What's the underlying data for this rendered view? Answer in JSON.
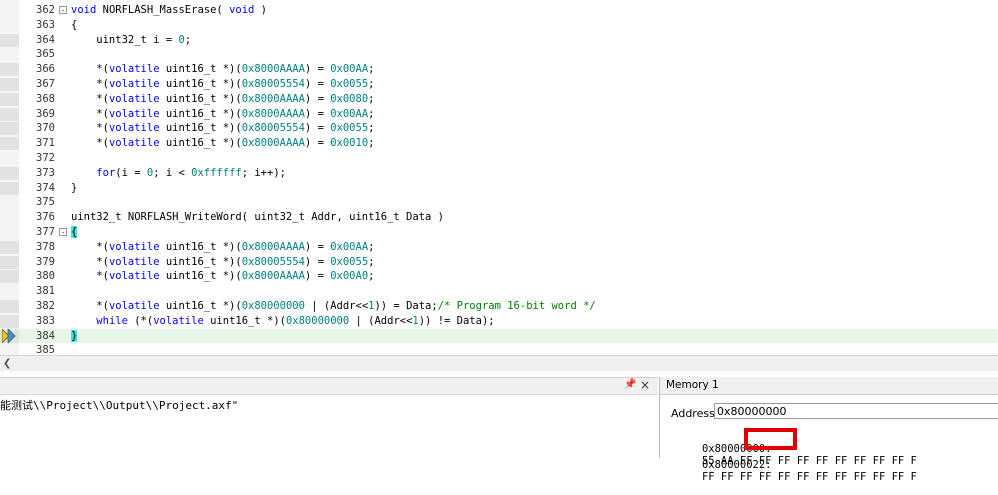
{
  "editor": {
    "current_line": "384",
    "lines": [
      {
        "num": "362",
        "text": "void NORFLASH_MassErase( void )",
        "fold": "-"
      },
      {
        "num": "363",
        "text": "{"
      },
      {
        "num": "364",
        "text": "    uint32_t i = 0;",
        "bp": true
      },
      {
        "num": "365",
        "text": ""
      },
      {
        "num": "366",
        "text": "    *(volatile uint16_t *)(0x8000AAAA) = 0x00AA;",
        "bp": true
      },
      {
        "num": "367",
        "text": "    *(volatile uint16_t *)(0x80005554) = 0x0055;",
        "bp": true
      },
      {
        "num": "368",
        "text": "    *(volatile uint16_t *)(0x8000AAAA) = 0x0080;",
        "bp": true
      },
      {
        "num": "369",
        "text": "    *(volatile uint16_t *)(0x8000AAAA) = 0x00AA;",
        "bp": true
      },
      {
        "num": "370",
        "text": "    *(volatile uint16_t *)(0x80005554) = 0x0055;",
        "bp": true
      },
      {
        "num": "371",
        "text": "    *(volatile uint16_t *)(0x8000AAAA) = 0x0010;",
        "bp": true
      },
      {
        "num": "372",
        "text": ""
      },
      {
        "num": "373",
        "text": "    for(i = 0; i < 0xffffff; i++);",
        "bp": true
      },
      {
        "num": "374",
        "text": "}",
        "bp": true
      },
      {
        "num": "375",
        "text": ""
      },
      {
        "num": "376",
        "text": "uint32_t NORFLASH_WriteWord( uint32_t Addr, uint16_t Data )"
      },
      {
        "num": "377",
        "text": "{",
        "fold": "-"
      },
      {
        "num": "378",
        "text": "    *(volatile uint16_t *)(0x8000AAAA) = 0x00AA;",
        "bp": true
      },
      {
        "num": "379",
        "text": "    *(volatile uint16_t *)(0x80005554) = 0x0055;",
        "bp": true
      },
      {
        "num": "380",
        "text": "    *(volatile uint16_t *)(0x8000AAAA) = 0x00A0;",
        "bp": true
      },
      {
        "num": "381",
        "text": ""
      },
      {
        "num": "382",
        "text": "    *(volatile uint16_t *)(0x80000000 | (Addr<<1)) = Data;/* Program 16-bit word */",
        "bp": true
      },
      {
        "num": "383",
        "text": "    while (*(volatile uint16_t *)(0x80000000 | (Addr<<1)) != Data);",
        "bp": true
      },
      {
        "num": "384",
        "text": "}",
        "bp": true
      },
      {
        "num": "385",
        "text": ""
      }
    ]
  },
  "output": {
    "pin_icon": "pin-icon",
    "close_icon": "close-icon",
    "text": "能测试\\\\Project\\\\Output\\\\Project.axf\""
  },
  "memory": {
    "tab_label": "Memory 1",
    "address_label": "Address:",
    "address_value": "0x80000000",
    "rows": [
      {
        "addr": "0x80000000:",
        "bytes": "55 AA FF FF FF FF FF FF FF FF FF F"
      },
      {
        "addr": "0x80000022:",
        "bytes": "FF FF FF FF FF FF FF FF FF FF FF F"
      }
    ],
    "highlight_color": "#e00000"
  },
  "colors": {
    "keyword": "#0000ff",
    "number": "#008080",
    "comment": "#008000",
    "current_line_bg": "#e9f6ea",
    "brace_match": "#3fe3e3"
  }
}
